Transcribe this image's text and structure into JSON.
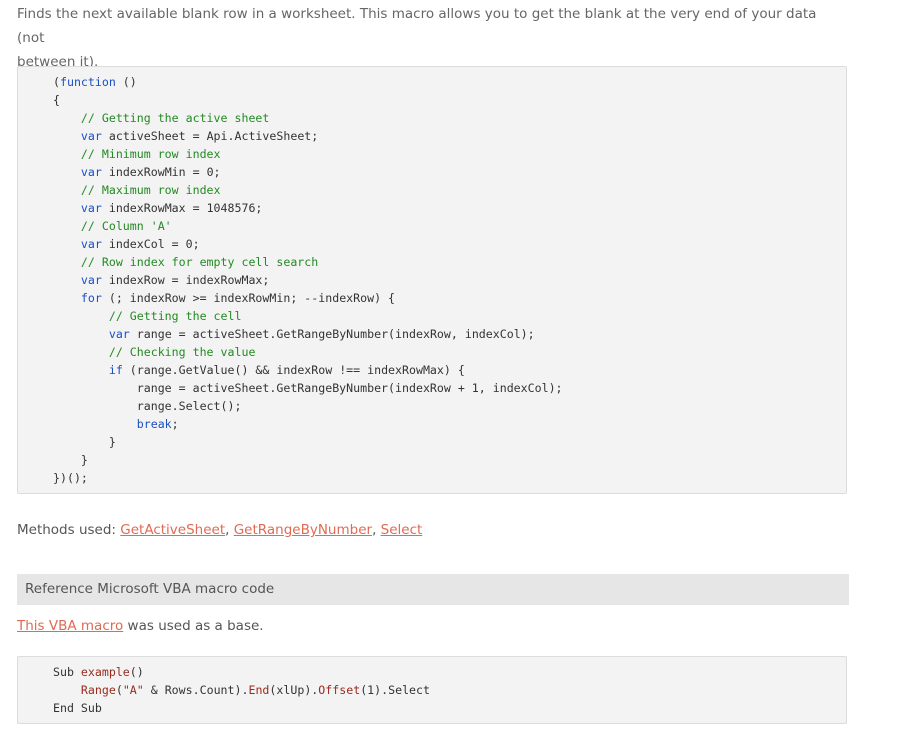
{
  "intro": {
    "line1": "Finds the next available blank row in a worksheet. This macro allows you to get the blank at the very end of your data (not",
    "line2": "between it)."
  },
  "js_code": {
    "l1": "(function ()",
    "l2": "{",
    "l3": "    // Getting the active sheet",
    "l4": "    var activeSheet = Api.ActiveSheet;",
    "l5": "    // Minimum row index",
    "l6": "    var indexRowMin = 0;",
    "l7": "    // Maximum row index",
    "l8": "    var indexRowMax = 1048576;",
    "l9": "    // Column 'A'",
    "l10": "    var indexCol = 0;",
    "l11": "    // Row index for empty cell search",
    "l12": "    var indexRow = indexRowMax;",
    "l13": "    for (; indexRow >= indexRowMin; --indexRow) {",
    "l14": "        // Getting the cell",
    "l15": "        var range = activeSheet.GetRangeByNumber(indexRow, indexCol);",
    "l16": "        // Checking the value",
    "l17": "        if (range.GetValue() && indexRow !== indexRowMax) {",
    "l18": "            range = activeSheet.GetRangeByNumber(indexRow + 1, indexCol);",
    "l19": "            range.Select();",
    "l20": "            break;",
    "l21": "        }",
    "l22": "    }",
    "l23": "})();"
  },
  "methods": {
    "prefix": "Methods used: ",
    "links": [
      "GetActiveSheet",
      "GetRangeByNumber",
      "Select"
    ],
    "separator": ", "
  },
  "reference": {
    "heading": "Reference Microsoft VBA macro code",
    "link_text": "This VBA macro",
    "suffix": " was used as a base."
  },
  "vba_code": {
    "l1": "Sub example()",
    "l2": "    Range(\"A\" & Rows.Count).End(xlUp).Offset(1).Select",
    "l3": "End Sub"
  },
  "colors": {
    "link": "#e06a52",
    "keyword": "#1a4fc4",
    "comment": "#228b22",
    "code_bg": "#f3f3f3",
    "heading_bg": "#e6e6e6"
  }
}
